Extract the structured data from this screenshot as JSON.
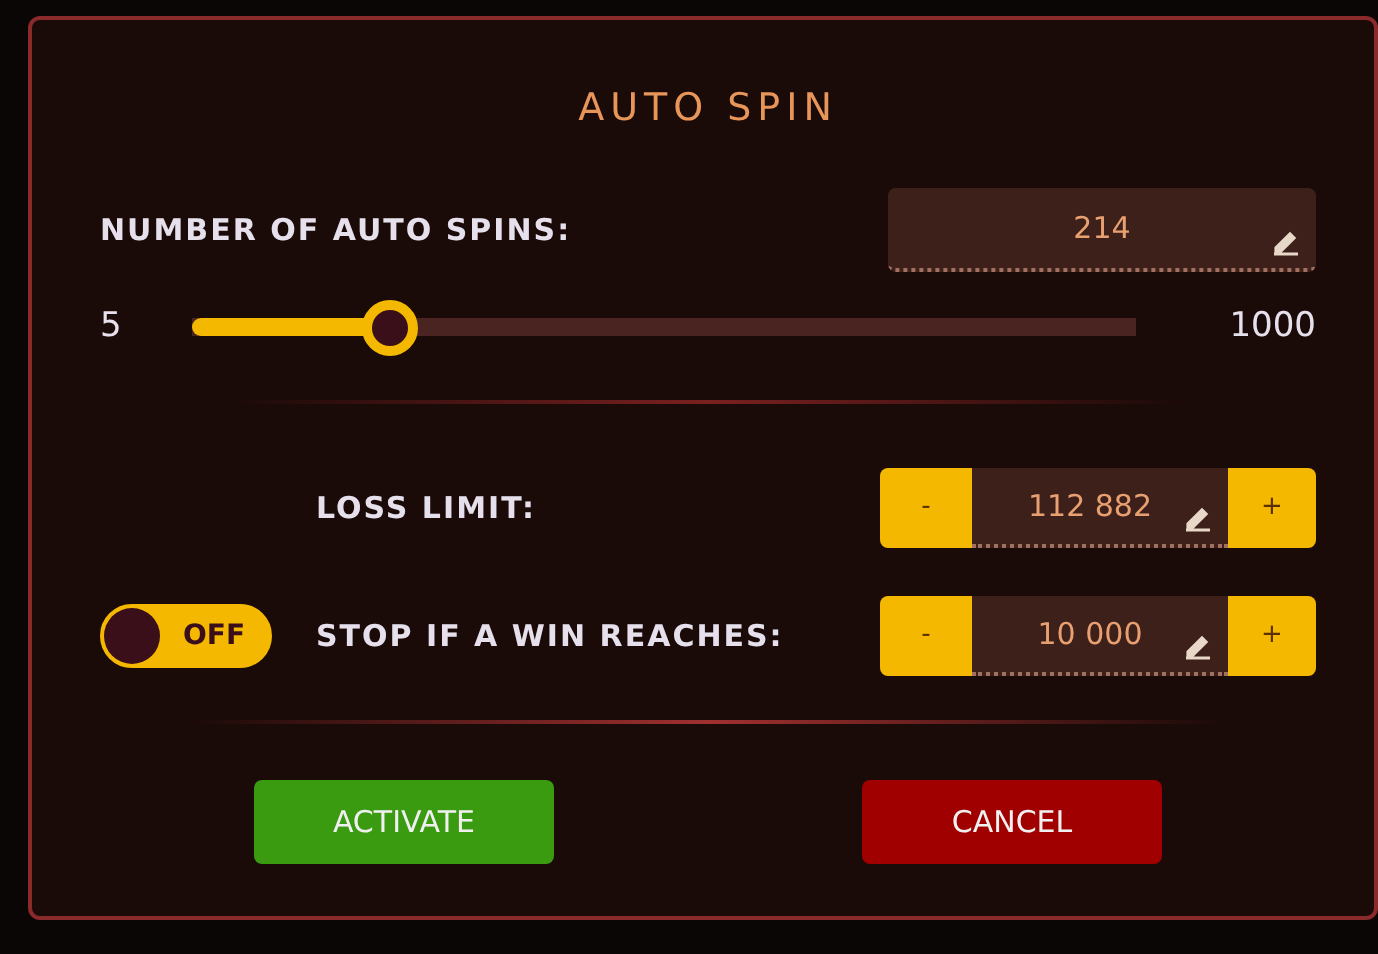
{
  "title": "AUTO SPIN",
  "spins": {
    "label": "NUMBER OF AUTO SPINS:",
    "value": "214"
  },
  "slider": {
    "min": "5",
    "max": "1000",
    "level": 0.21
  },
  "limits": [
    {
      "label": "LOSS LIMIT:",
      "minus": "-",
      "value": "112 882",
      "plus": "+"
    },
    {
      "label": "STOP IF A WIN REACHES:",
      "minus": "-",
      "value": "10 000",
      "plus": "+",
      "toggle": {
        "on": false,
        "text": "OFF"
      }
    }
  ],
  "buttons": [
    {
      "label": "ACTIVATE",
      "kind": "confirm"
    },
    {
      "label": "CANCEL",
      "kind": "cancel"
    }
  ]
}
